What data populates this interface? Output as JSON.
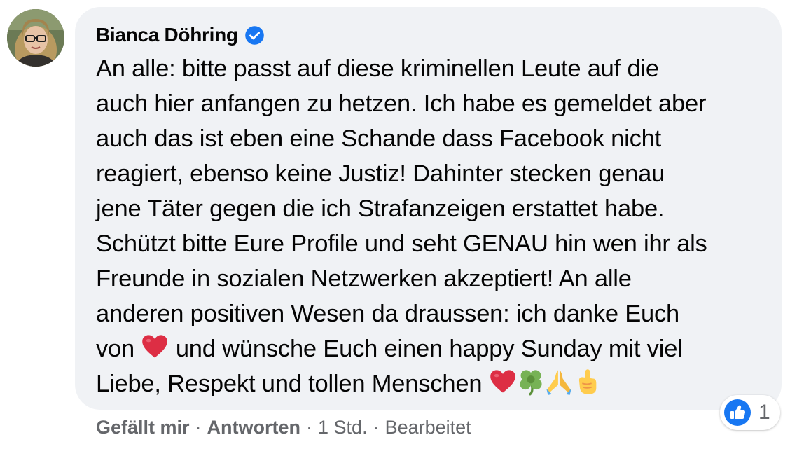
{
  "comment": {
    "author": "Bianca Döhring",
    "verified": true,
    "text_lines": [
      "An alle: bitte passt auf diese kriminellen Leute auf die",
      "auch hier anfangen zu hetzen. Ich habe es gemeldet aber",
      "auch das ist eben eine Schande dass Facebook nicht",
      "reagiert, ebenso keine Justiz! Dahinter stecken genau",
      "jene Täter gegen die ich Strafanzeigen erstattet habe.",
      "Schützt bitte Eure Profile und seht GENAU hin wen ihr als",
      "Freunde in sozialen Netzwerken akzeptiert! An alle",
      "anderen positiven Wesen da draussen: ich danke Euch"
    ],
    "line9_before": "von",
    "line9_after": "und wünsche Euch einen happy Sunday mit viel",
    "line10_text": "Liebe, Respekt und tollen Menschen",
    "emojis_inline": [
      "heart-emoji"
    ],
    "emojis_trailing": [
      "heart-emoji",
      "shamrock-emoji",
      "folded-hands-emoji",
      "hand-gesture-emoji"
    ]
  },
  "reactions": {
    "icon": "like-icon",
    "count": "1"
  },
  "actions": {
    "like_label": "Gefällt mir",
    "reply_label": "Antworten",
    "separator": "·",
    "time": "1 Std.",
    "edited": "Bearbeitet"
  },
  "colors": {
    "bubble": "#f0f2f5",
    "text": "#050505",
    "secondary": "#65676b",
    "verified": "#1877f2",
    "like": "#1877f2"
  }
}
